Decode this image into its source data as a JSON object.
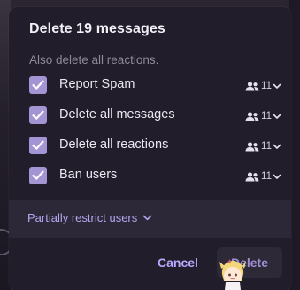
{
  "dialog": {
    "title": "Delete 19 messages",
    "subtitle": "Also delete all reactions.",
    "options": [
      {
        "label": "Report Spam",
        "checked": true,
        "user_count": "11"
      },
      {
        "label": "Delete all messages",
        "checked": true,
        "user_count": "11"
      },
      {
        "label": "Delete all reactions",
        "checked": true,
        "user_count": "11"
      },
      {
        "label": "Ban users",
        "checked": true,
        "user_count": "11"
      }
    ],
    "restrict_label": "Partially restrict users",
    "cancel_label": "Cancel",
    "delete_label": "Delete"
  },
  "colors": {
    "checkbox": "#a394d4",
    "accent": "#b9a8ff",
    "dialog_bg": "#221d2a"
  },
  "icons": {
    "checkbox": "check-icon",
    "users": "users-icon",
    "dropdown": "chevron-down-icon",
    "cursor": "anime-cursor-icon"
  }
}
